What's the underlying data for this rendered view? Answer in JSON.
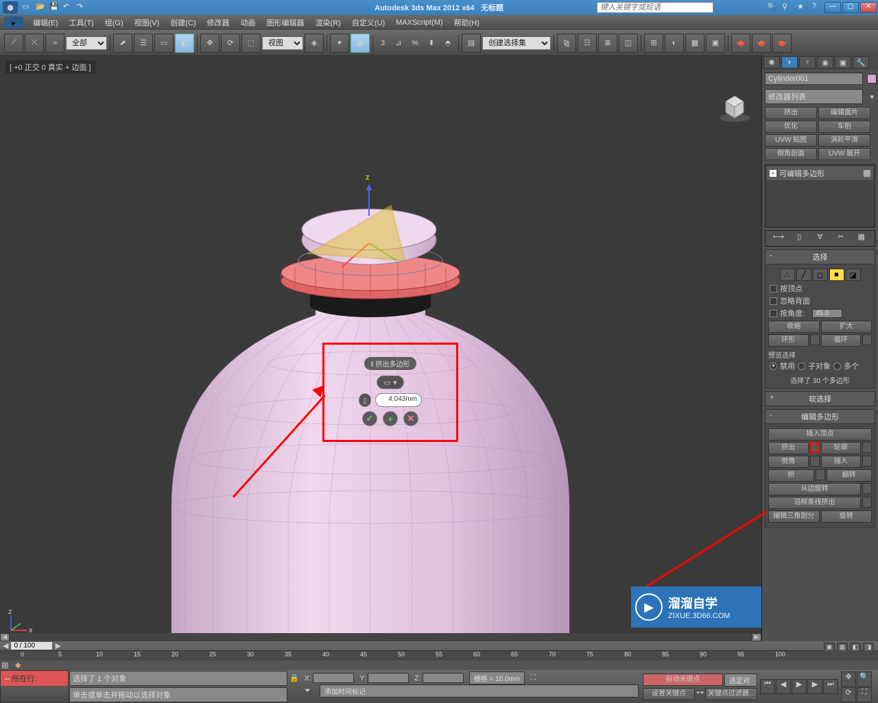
{
  "title": {
    "app": "Autodesk 3ds Max  2012 x64",
    "doc": "无标题"
  },
  "search_placeholder": "键入关键字或短语",
  "menu": [
    "编辑(E)",
    "工具(T)",
    "组(G)",
    "视图(V)",
    "创建(C)",
    "修改器",
    "动画",
    "图形编辑器",
    "渲染(R)",
    "自定义(U)",
    "MAXScript(M)",
    "帮助(H)"
  ],
  "toolbar": {
    "selection_filter": "全部",
    "ref_coord": "视图",
    "named_set": "创建选择集"
  },
  "viewport_label": "[ +0 正交 0 真实 + 边面 ]",
  "caddy": {
    "title": "‖ 挤出多边形",
    "amount": "4.043mm"
  },
  "watermark": {
    "line1": "溜溜自学",
    "line2": "ZIXUE.3D66.COM"
  },
  "right_panel": {
    "object_name": "Cylinder001",
    "modifier_list": "修改器列表",
    "mod_buttons": [
      "挤出",
      "编辑面片",
      "优化",
      "车削",
      "UVW 贴图",
      "涡轮平滑",
      "倒角剖面",
      "UVW 展开"
    ],
    "stack_item": "可编辑多边形",
    "selection": {
      "title": "选择",
      "by_vertex": "按顶点",
      "ignore_backfacing": "忽略背面",
      "by_angle": "按角度:",
      "angle": "45.0",
      "shrink": "收缩",
      "grow": "扩大",
      "ring": "环形",
      "loop": "循环",
      "preview_label": "预览选择",
      "preview_off": "禁用",
      "preview_subobj": "子对象",
      "preview_multi": "多个",
      "sel_count": "选择了 30 个多边形"
    },
    "soft_sel": "软选择",
    "edit_poly": {
      "title": "编辑多边形",
      "insert_vertex": "插入顶点",
      "extrude": "挤出",
      "outline": "轮廓",
      "bevel": "倒角",
      "inset": "插入",
      "bridge": "桥",
      "flip": "翻转",
      "hinge": "从边旋转",
      "extrude_spline": "沿样条线挤出",
      "edit_tri": "编辑三角剖分",
      "retri": "旋转"
    }
  },
  "timeline": {
    "frame": "0 / 100",
    "ticks": [
      "0",
      "5",
      "10",
      "15",
      "20",
      "25",
      "30",
      "35",
      "40",
      "45",
      "50",
      "55",
      "60",
      "65",
      "70",
      "75",
      "80",
      "85",
      "90",
      "95",
      "100"
    ]
  },
  "status": {
    "current": "所在行:",
    "sel_msg": "选择了 1 个对象",
    "prompt": "单击或单击并拖动以选择对象",
    "x": "X:",
    "y": "Y:",
    "z": "Z:",
    "grid": "栅格 = 10.0mm",
    "add_time_tag": "添加时间标记",
    "auto_key": "自动关键点",
    "sel_lock": "选定对",
    "set_key": "设置关键点",
    "key_filters": "关键点过滤器..."
  }
}
